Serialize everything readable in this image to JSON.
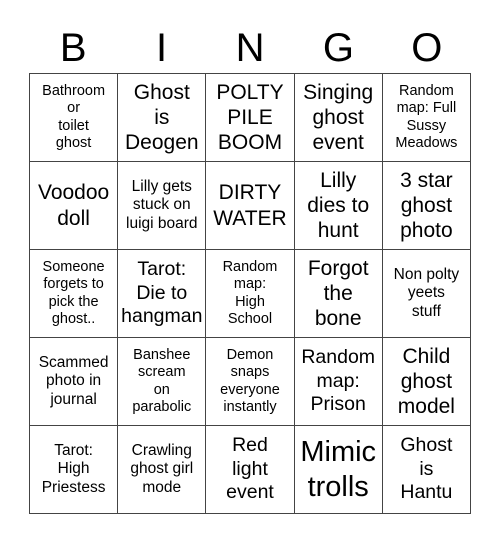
{
  "header": [
    "B",
    "I",
    "N",
    "G",
    "O"
  ],
  "cells": [
    {
      "text": "Bathroom or toilet ghost",
      "size": "s14",
      "lines": [
        "Bathroom",
        "or",
        "toilet",
        "ghost"
      ]
    },
    {
      "text": "Ghost is Deogen",
      "size": "s21",
      "lines": [
        "Ghost",
        "is",
        "Deogen"
      ]
    },
    {
      "text": "POLTY PILE BOOM",
      "size": "s21",
      "lines": [
        "POLTY",
        "PILE",
        "BOOM"
      ]
    },
    {
      "text": "Singing ghost event",
      "size": "s21",
      "lines": [
        "Singing",
        "ghost",
        "event"
      ]
    },
    {
      "text": "Random map: Full Sussy Meadows",
      "size": "s14",
      "lines": [
        "Random",
        "map: Full",
        "Sussy",
        "Meadows"
      ]
    },
    {
      "text": "Voodoo doll",
      "size": "s21",
      "lines": [
        "Voodoo",
        "doll"
      ]
    },
    {
      "text": "Lilly gets stuck on luigi board",
      "size": "s15",
      "lines": [
        "Lilly gets",
        "stuck on",
        "luigi board"
      ]
    },
    {
      "text": "DIRTY WATER",
      "size": "s21",
      "lines": [
        "DIRTY",
        "WATER"
      ]
    },
    {
      "text": "Lilly dies to hunt",
      "size": "s21",
      "lines": [
        "Lilly",
        "dies to",
        "hunt"
      ]
    },
    {
      "text": "3 star ghost photo",
      "size": "s21",
      "lines": [
        "3 star",
        "ghost",
        "photo"
      ]
    },
    {
      "text": "Someone forgets to pick the ghost..",
      "size": "s14",
      "lines": [
        "Someone",
        "forgets to",
        "pick the",
        "ghost.."
      ]
    },
    {
      "text": "Tarot: Die to hangman",
      "size": "s19",
      "lines": [
        "Tarot:",
        "Die to",
        "hangman"
      ]
    },
    {
      "text": "Random map: High School",
      "size": "s14",
      "lines": [
        "Random",
        "map:",
        "High",
        "School"
      ]
    },
    {
      "text": "Forgot the bone",
      "size": "s21",
      "lines": [
        "Forgot",
        "the",
        "bone"
      ]
    },
    {
      "text": "Non polty yeets stuff",
      "size": "s15",
      "lines": [
        "Non polty",
        "yeets",
        "stuff"
      ]
    },
    {
      "text": "Scammed photo in journal",
      "size": "s15",
      "lines": [
        "Scammed",
        "photo in",
        "journal"
      ]
    },
    {
      "text": "Banshee scream on parabolic",
      "size": "s14",
      "lines": [
        "Banshee",
        "scream",
        "on",
        "parabolic"
      ]
    },
    {
      "text": "Demon snaps everyone instantly",
      "size": "s14",
      "lines": [
        "Demon",
        "snaps",
        "everyone",
        "instantly"
      ]
    },
    {
      "text": "Random map: Prison",
      "size": "s19",
      "lines": [
        "Random",
        "map:",
        "Prison"
      ]
    },
    {
      "text": "Child ghost model",
      "size": "s21",
      "lines": [
        "Child",
        "ghost",
        "model"
      ]
    },
    {
      "text": "Tarot: High Priestess",
      "size": "s15",
      "lines": [
        "Tarot:",
        "High",
        "Priestess"
      ]
    },
    {
      "text": "Crawling ghost girl mode",
      "size": "s15",
      "lines": [
        "Crawling",
        "ghost girl",
        "mode"
      ]
    },
    {
      "text": "Red light event",
      "size": "s19",
      "lines": [
        "Red",
        "light",
        "event"
      ]
    },
    {
      "text": "Mimic trolls",
      "size": "s29",
      "lines": [
        "Mimic",
        "trolls"
      ]
    },
    {
      "text": "Ghost is Hantu",
      "size": "s19",
      "lines": [
        "Ghost",
        "is",
        "Hantu"
      ]
    }
  ]
}
